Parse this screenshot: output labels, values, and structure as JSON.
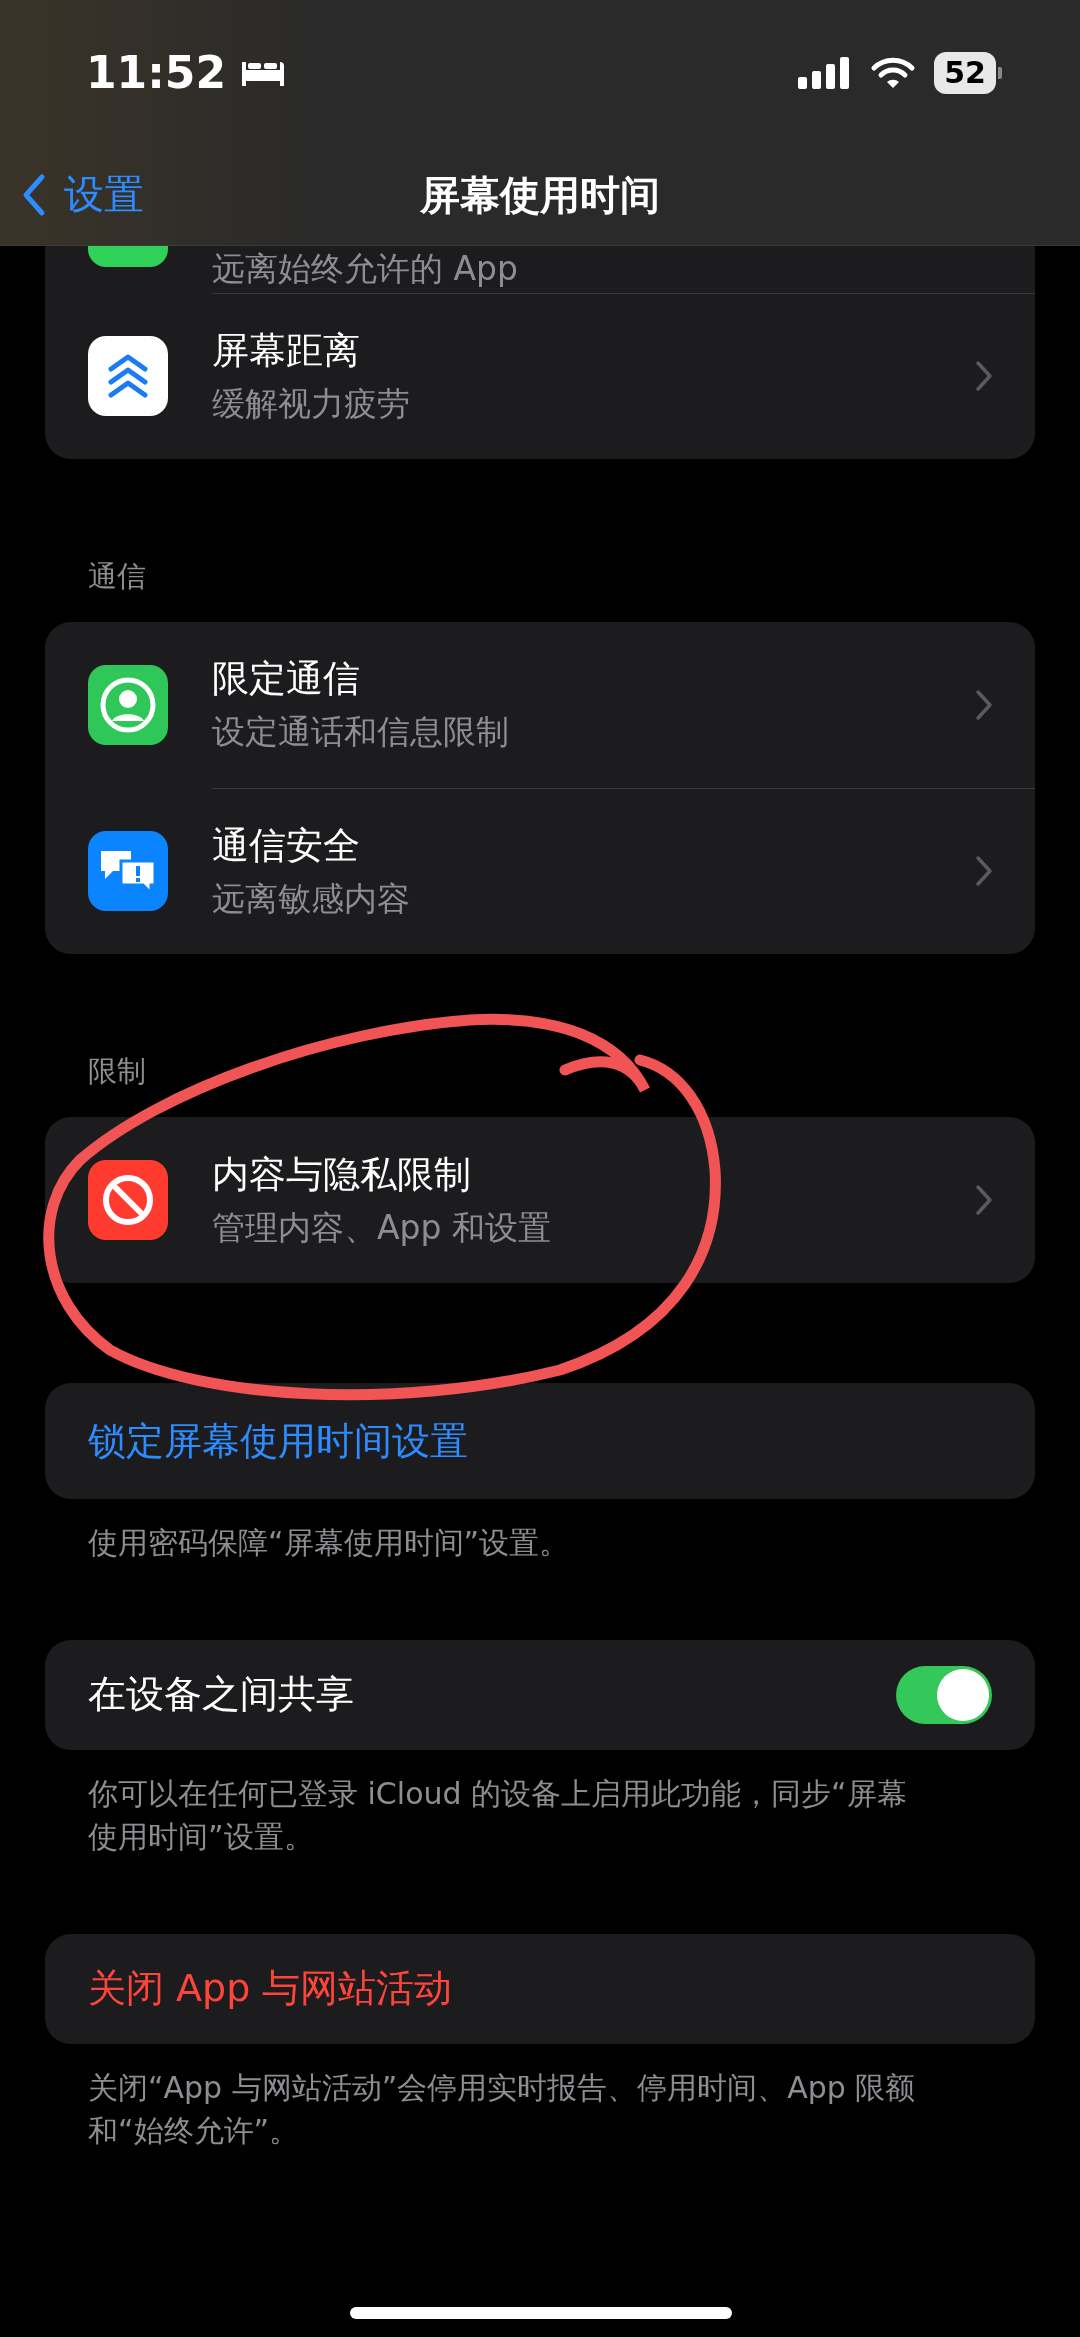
{
  "status_bar": {
    "time": "11:52",
    "battery": "52"
  },
  "nav": {
    "back_label": "设置",
    "title": "屏幕使用时间"
  },
  "groups": [
    {
      "rows": [
        {
          "subtitle": "远离始终允许的 App"
        },
        {
          "title": "屏幕距离",
          "subtitle": "缓解视力疲劳"
        }
      ]
    },
    {
      "header": "通信",
      "rows": [
        {
          "title": "限定通信",
          "subtitle": "设定通话和信息限制"
        },
        {
          "title": "通信安全",
          "subtitle": "远离敏感内容"
        }
      ]
    },
    {
      "header": "限制",
      "rows": [
        {
          "title": "内容与隐私限制",
          "subtitle": "管理内容、App 和设置"
        }
      ]
    }
  ],
  "actions": [
    {
      "kind": "link",
      "label": "锁定屏幕使用时间设置",
      "footer": "使用密码保障“屏幕使用时间”设置。"
    },
    {
      "kind": "toggle",
      "label": "在设备之间共享",
      "on": true,
      "footer": "你可以在任何已登录 iCloud 的设备上启用此功能，同步“屏幕使用时间”设置。"
    },
    {
      "kind": "destructive",
      "label": "关闭 App 与网站活动",
      "footer": "关闭“App 与网站活动”会停用实时报告、停用时间、App 限额和“始终允许”。"
    }
  ]
}
